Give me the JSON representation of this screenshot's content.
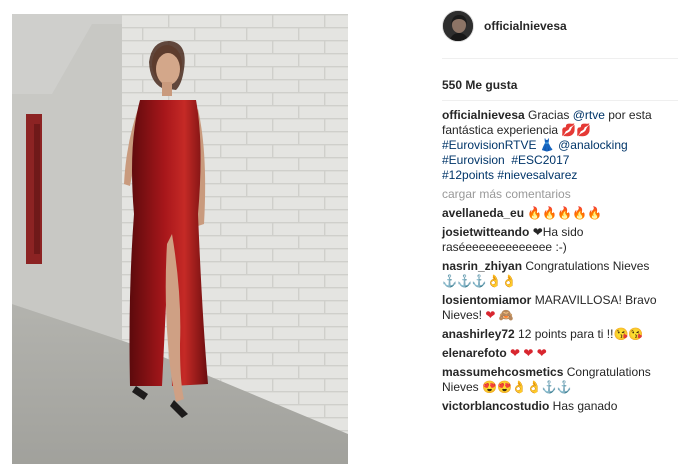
{
  "post": {
    "username": "officialnievesa",
    "likes": "550 Me gusta",
    "caption": {
      "user": "officialnievesa",
      "t1": " Gracias ",
      "m1": "@rtve",
      "t2": " por esta fantástica experiencia ",
      "emoji": "💋💋",
      "h1": "#EurovisionRTVE",
      "emoji2": " 👗 ",
      "m2": "@analocking",
      "h2": "#Eurovision",
      "h3": "#ESC2017",
      "h4": "#12points",
      "h5": "#nievesalvarez"
    },
    "load_more": "cargar más comentarios",
    "comments": [
      {
        "user": "avellaneda_eu",
        "text": " 🔥🔥🔥🔥🔥"
      },
      {
        "user": "josietwitteando",
        "heart": "❤",
        "text": "Ha sido raséeeeeeeeeeeeee :-)"
      },
      {
        "user": "nasrin_zhiyan",
        "text": " Congratulations Nieves",
        "emojis": "⚓⚓⚓👌👌"
      },
      {
        "user": "losientomiamor",
        "text": " MARAVILLOSA! Bravo Nieves! ",
        "emojis": "❤ 🙈"
      },
      {
        "user": "anashirley72",
        "text": " 12 points para ti !!",
        "emojis": "😘😘"
      },
      {
        "user": "elenarefoto",
        "text": " ",
        "emojis": "❤ ❤ ❤"
      },
      {
        "user": "massumehcosmetics",
        "text": " Congratulations Nieves",
        "emojis": "😍😍👌👌⚓⚓"
      },
      {
        "user": "victorblancostudio",
        "text": " Has ganado"
      }
    ]
  }
}
